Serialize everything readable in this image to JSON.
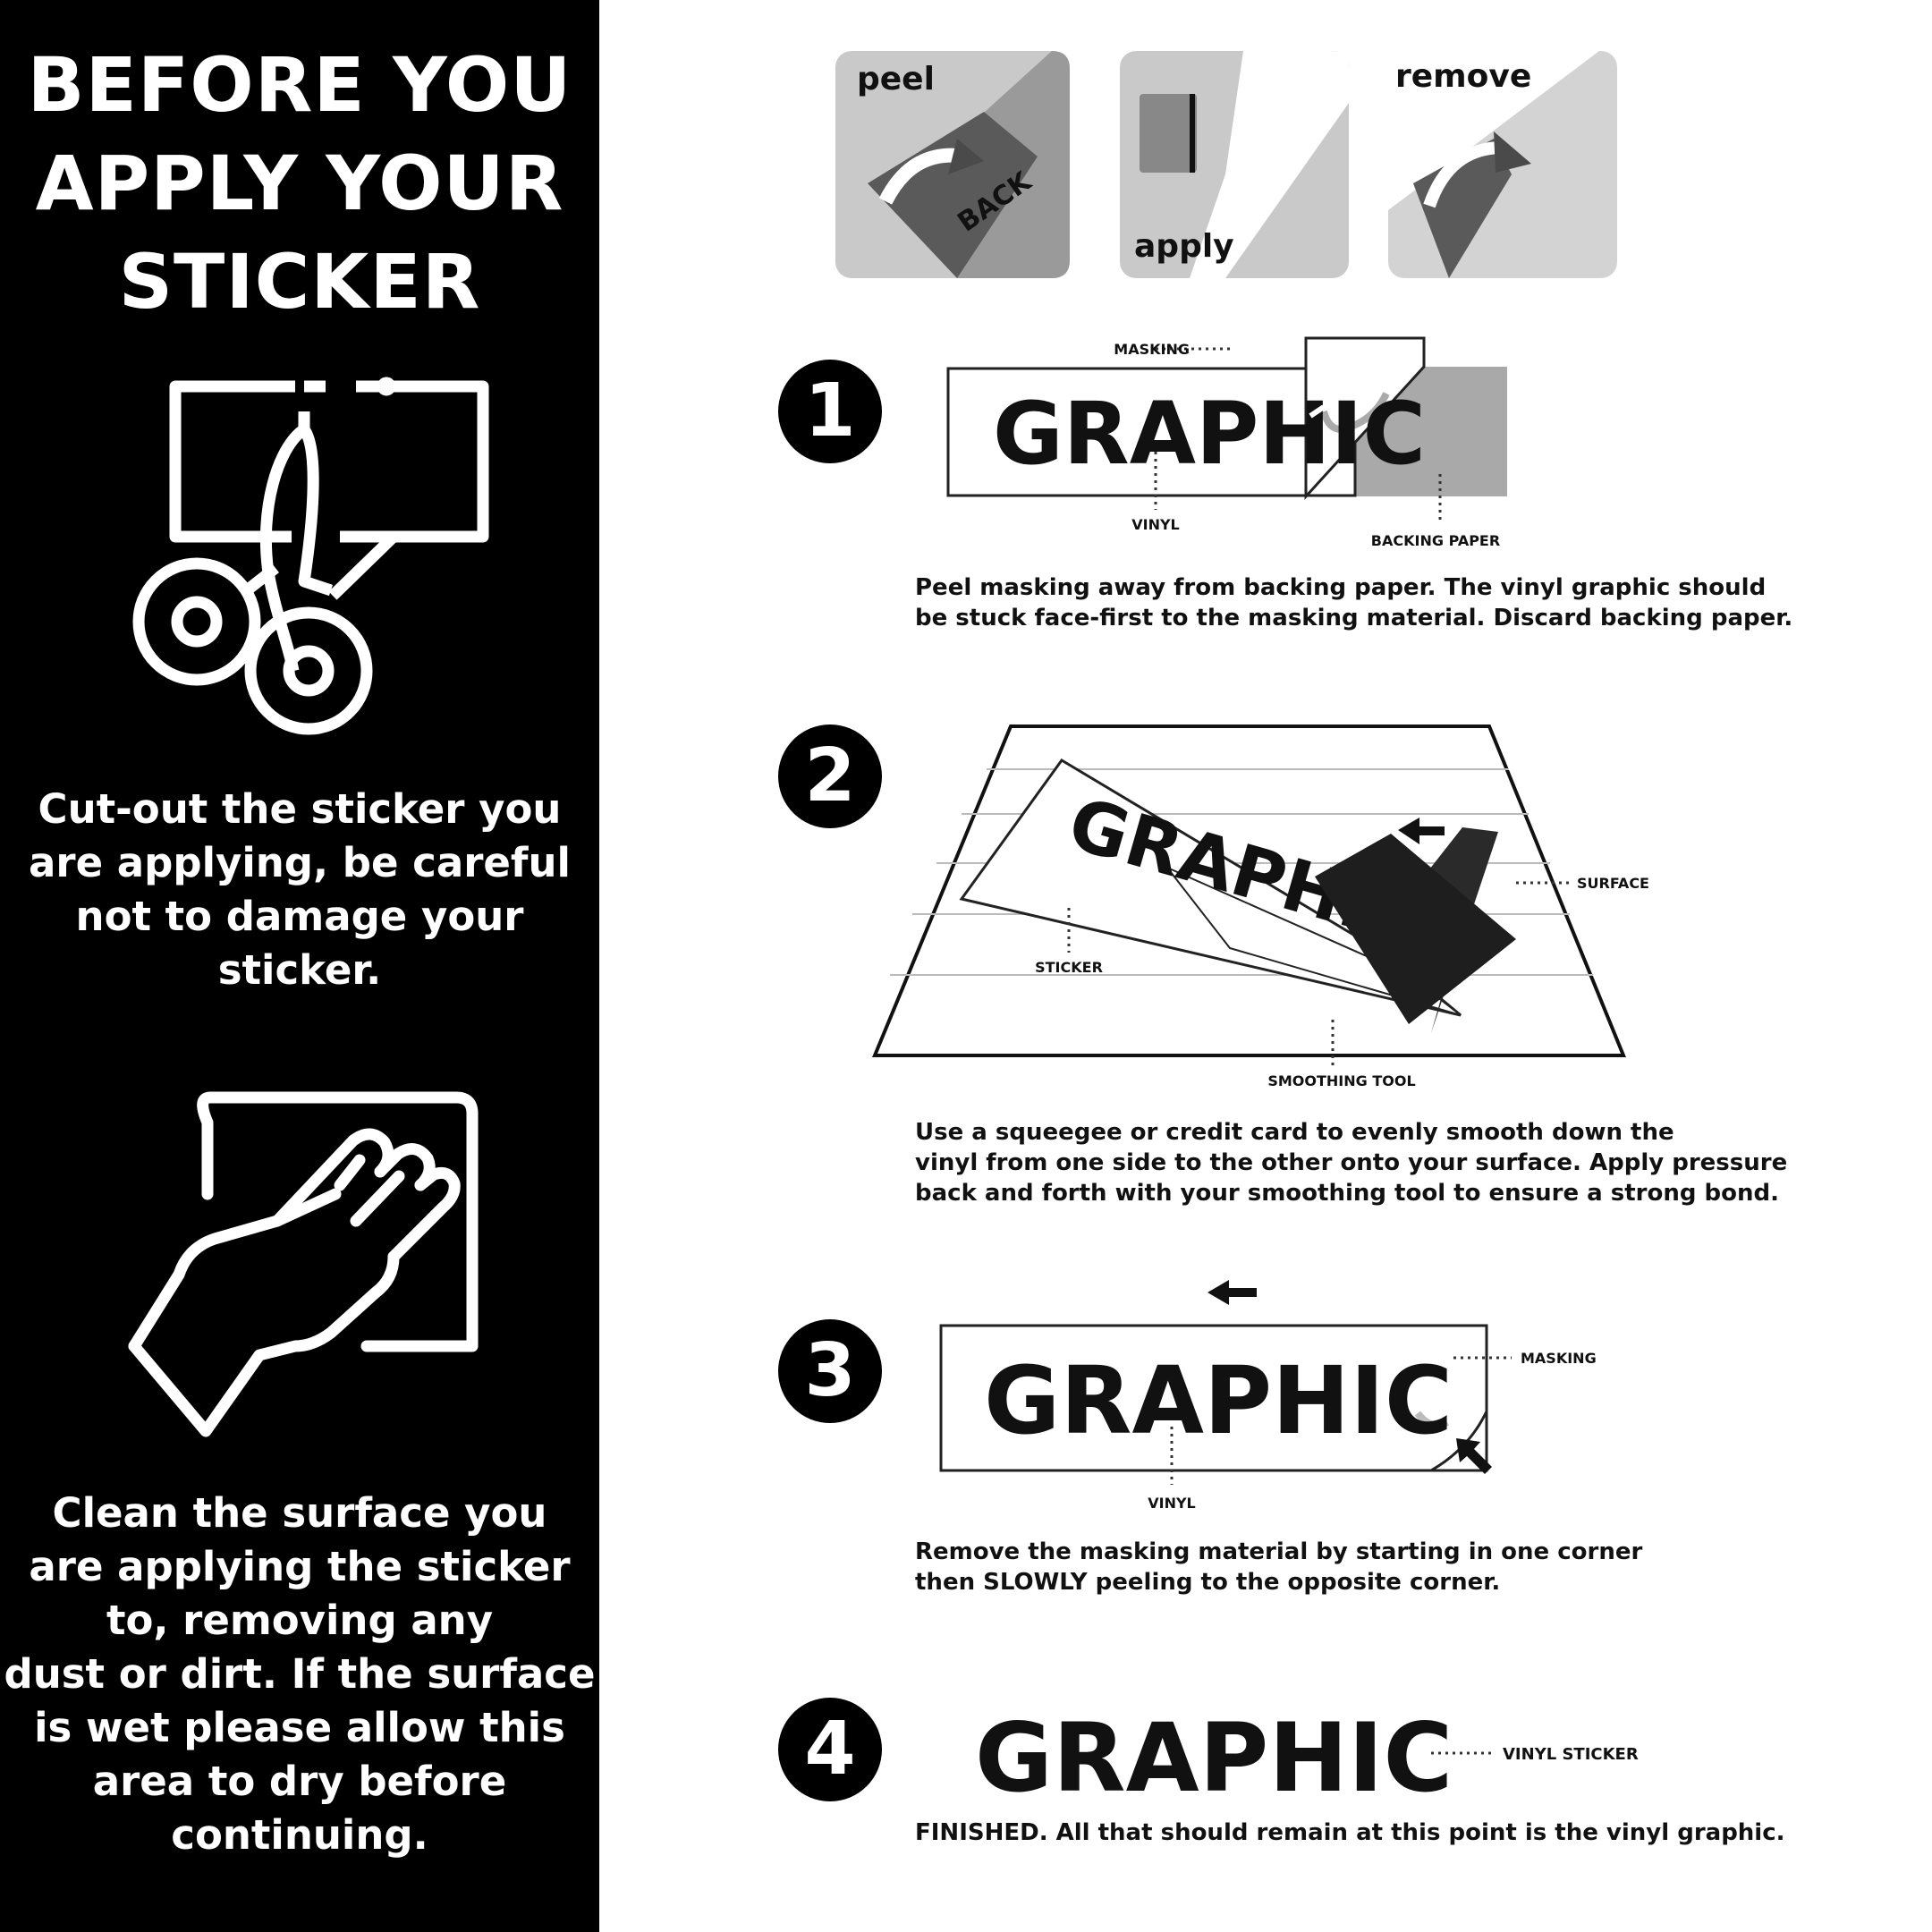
{
  "left_panel": {
    "title_lines": [
      "BEFORE YOU",
      "APPLY YOUR",
      "STICKER"
    ],
    "cut_text_lines": [
      "Cut-out the sticker you",
      "are applying, be careful",
      "not to damage your",
      "sticker."
    ],
    "clean_text_lines": [
      "Clean the surface you",
      "are applying the sticker",
      "to, removing any",
      "dust or dirt. If the surface",
      "is wet please allow this",
      "area to dry before",
      "continuing."
    ],
    "icons": [
      "scissors-icon",
      "hand-wiping-icon"
    ]
  },
  "overview": {
    "peel_label": "peel",
    "back_label": "BACK",
    "apply_label": "apply",
    "remove_label": "remove"
  },
  "graphic_word": "GRAPHIC",
  "steps": [
    {
      "number": "1",
      "labels": {
        "masking": "MASKING",
        "vinyl": "VINYL",
        "backing_paper": "BACKING PAPER"
      },
      "lines": [
        "Peel masking away from backing paper. The vinyl graphic should",
        "be stuck face-first to the masking material. Discard backing paper."
      ]
    },
    {
      "number": "2",
      "labels": {
        "surface": "SURFACE",
        "sticker": "STICKER",
        "smoothing_tool": "SMOOTHING TOOL"
      },
      "lines": [
        "Use a squeegee or credit card to evenly smooth down the",
        "vinyl from one side to the other onto your surface. Apply pressure",
        "back and forth with your smoothing tool to ensure a strong bond."
      ]
    },
    {
      "number": "3",
      "labels": {
        "masking": "MASKING",
        "vinyl": "VINYL"
      },
      "lines": [
        "Remove the masking material by starting in one corner",
        "then SLOWLY peeling to the opposite corner."
      ]
    },
    {
      "number": "4",
      "labels": {
        "vinyl_sticker": "VINYL STICKER"
      },
      "lines": [
        "FINISHED. All that should remain at this point is the vinyl graphic."
      ]
    }
  ]
}
